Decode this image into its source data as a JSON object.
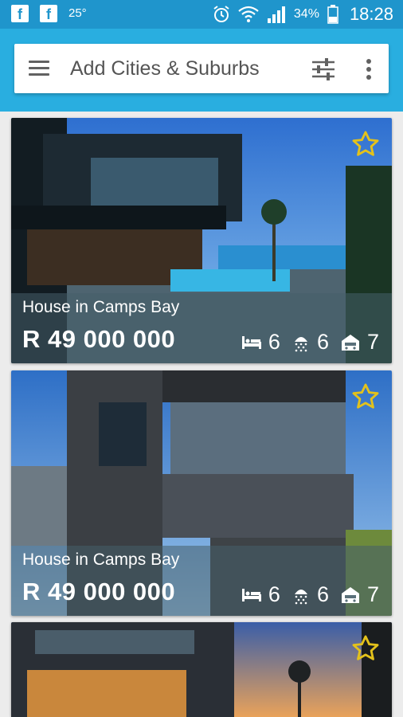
{
  "status_bar": {
    "temperature": "25°",
    "battery_percent": "34%",
    "time": "18:28"
  },
  "search": {
    "placeholder": "Add Cities & Suburbs"
  },
  "listings": [
    {
      "title": "House in Camps Bay",
      "price": "R 49 000 000",
      "bedrooms": "6",
      "bathrooms": "6",
      "garages": "7"
    },
    {
      "title": "House in Camps Bay",
      "price": "R 49 000 000",
      "bedrooms": "6",
      "bathrooms": "6",
      "garages": "7"
    },
    {
      "title": "",
      "price": "",
      "bedrooms": "",
      "bathrooms": "",
      "garages": ""
    }
  ],
  "colors": {
    "status_bar": "#1f95cc",
    "app_bar": "#29aee0",
    "star": "#e4c21b",
    "overlay": "#465f69"
  }
}
